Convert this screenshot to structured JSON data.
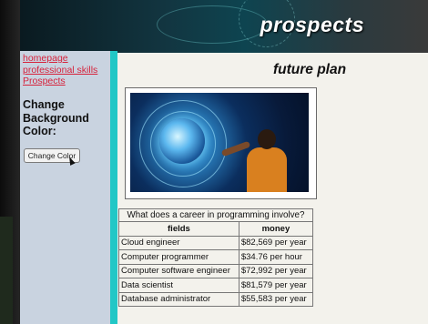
{
  "header": {
    "title": "prospects"
  },
  "sidebar": {
    "links": [
      "homepage",
      "professional skills",
      "Prospects"
    ],
    "bg_label": "Change Background Color:",
    "button_label": "Change Color"
  },
  "main": {
    "title": "future plan",
    "image_alt": "woman interacting with holographic globe",
    "table": {
      "caption": "What does a career in programming involve?",
      "headers": [
        "fields",
        "money"
      ],
      "rows": [
        [
          "Cloud engineer",
          "$82,569 per year"
        ],
        [
          "Computer programmer",
          "$34.76 per hour"
        ],
        [
          "Computer software engineer",
          "$72,992 per year"
        ],
        [
          "Data scientist",
          "$81,579 per year"
        ],
        [
          "Database administrator",
          "$55,583 per year"
        ]
      ]
    }
  },
  "colors": {
    "accent": "#21c7c6",
    "link": "#d6233c",
    "sidebar": "#c9d3e0",
    "content_bg": "#f3f2ec"
  }
}
